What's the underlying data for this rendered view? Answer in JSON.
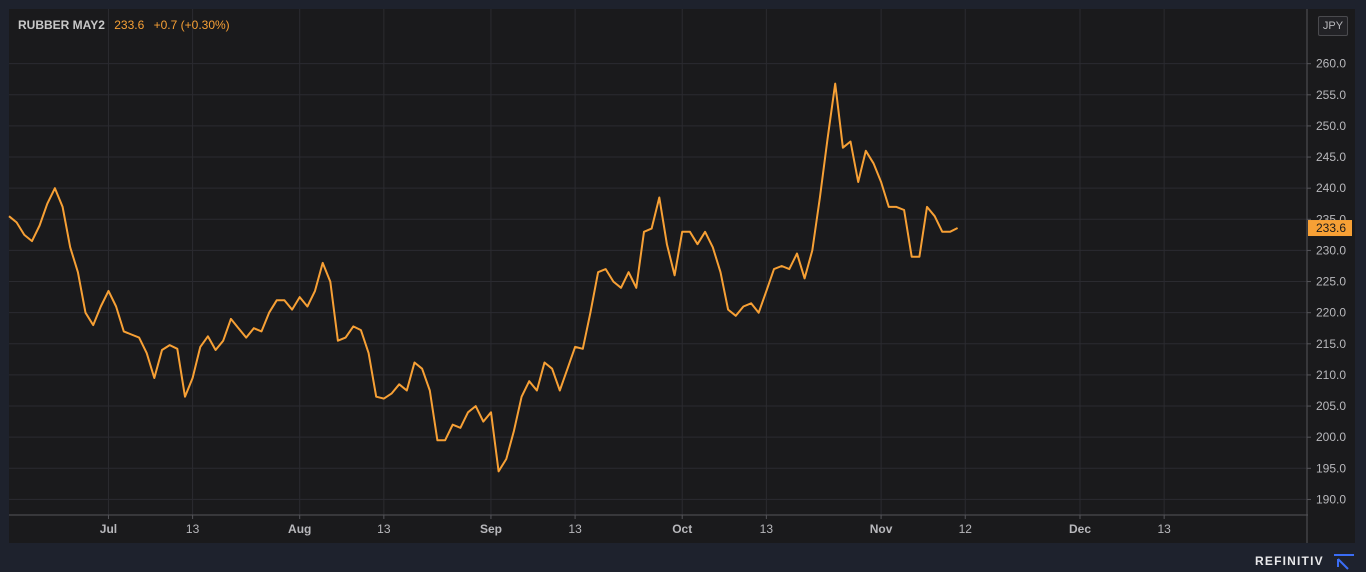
{
  "legend": {
    "symbol": "RUBBER MAY2",
    "last": "233.6",
    "change": "+0.7 (+0.30%)"
  },
  "currency_badge": "JPY",
  "brand": "REFINITIV",
  "brand_icon": "refinitiv-logo-icon",
  "colors": {
    "background": "#1a1a1c",
    "line": "#f7a035",
    "grid": "#2b2b30",
    "axis_text": "#b8b8bc",
    "last_price_tag": "#f7a035"
  },
  "chart_data": {
    "type": "line",
    "title": "",
    "xlabel": "",
    "ylabel": "",
    "ylim": [
      187.5,
      263
    ],
    "y_ticks": [
      190,
      195,
      200,
      205,
      210,
      215,
      220,
      225,
      230,
      235,
      240,
      245,
      250,
      255,
      260
    ],
    "x_ticks": [
      "Jul",
      "13",
      "Aug",
      "13",
      "Sep",
      "13",
      "Oct",
      "13",
      "Nov",
      "12",
      "Dec",
      "13"
    ],
    "x_tick_index": [
      13,
      24,
      38,
      49,
      63,
      74,
      88,
      99,
      114,
      125,
      140,
      151
    ],
    "grid": true,
    "last_price_label": "233.6",
    "series": [
      {
        "values": [
          235.5,
          234.5,
          232.5,
          231.5,
          234.0,
          237.5,
          240.0,
          237.0,
          230.5,
          226.5,
          220.0,
          218.0,
          221.0,
          223.5,
          221.0,
          217.0,
          216.5,
          216.0,
          213.5,
          209.5,
          214.0,
          214.8,
          214.2,
          206.5,
          209.5,
          214.5,
          216.2,
          214.0,
          215.5,
          219.0,
          217.5,
          216.0,
          217.5,
          217.0,
          220.0,
          222.0,
          222.0,
          220.5,
          222.5,
          221.0,
          223.5,
          228.0,
          225.0,
          215.5,
          216.0,
          217.8,
          217.2,
          213.5,
          206.5,
          206.2,
          207.0,
          208.5,
          207.5,
          212.0,
          211.0,
          207.5,
          199.5,
          199.5,
          202.0,
          201.5,
          204.0,
          205.0,
          202.5,
          204.0,
          194.5,
          196.5,
          201.0,
          206.5,
          209.0,
          207.5,
          212.0,
          211.0,
          207.5,
          211.0,
          214.5,
          214.2,
          220.0,
          226.5,
          227.0,
          225.0,
          224.0,
          226.5,
          224.0,
          233.0,
          233.5,
          238.5,
          231.0,
          226.0,
          233.0,
          233.0,
          231.0,
          233.0,
          230.5,
          226.5,
          220.5,
          219.5,
          221.0,
          221.5,
          220.0,
          223.5,
          227.0,
          227.5,
          227.0,
          229.5,
          225.5,
          230.0,
          238.5,
          248.0,
          256.8,
          246.5,
          247.5,
          241.0,
          246.0,
          244.0,
          241.0,
          237.0,
          237.0,
          236.5,
          229.0,
          229.0,
          237.0,
          235.5,
          233.0,
          233.0,
          233.6
        ]
      }
    ]
  }
}
